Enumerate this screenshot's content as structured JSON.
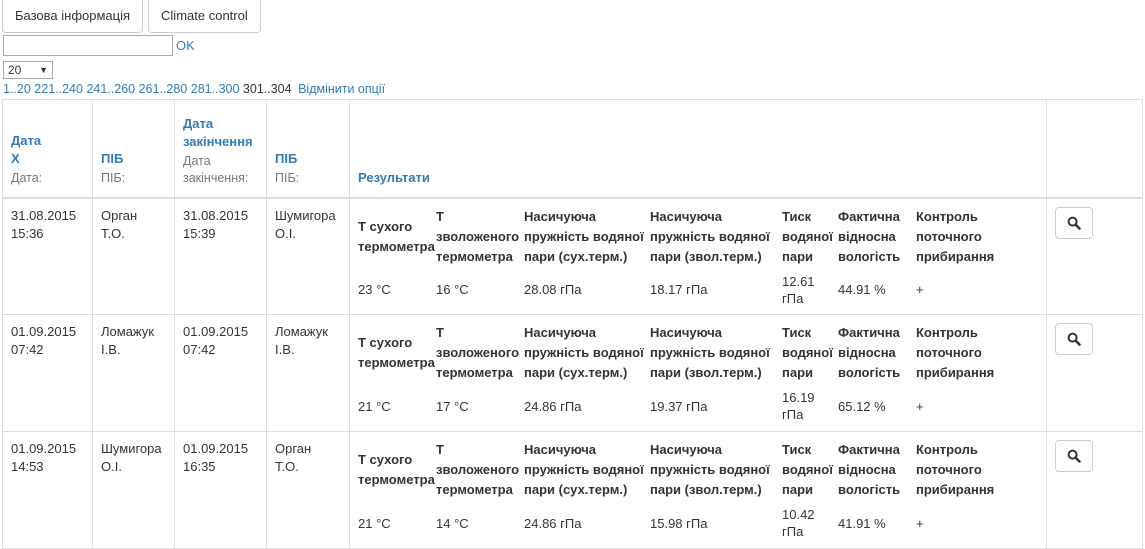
{
  "tabs": [
    "Базова інформація",
    "Climate control"
  ],
  "search": {
    "value": "",
    "ok_label": "OK"
  },
  "page_size": {
    "selected": "20"
  },
  "pager": {
    "links": [
      "1..20",
      "221..240",
      "241..260",
      "261..280",
      "281..300"
    ],
    "current": "301..304",
    "cancel_label": "Відмінити опції"
  },
  "table": {
    "headers": [
      {
        "title_line1": "Дата",
        "title_line2": "X",
        "sub": "Дата:"
      },
      {
        "title": "ПІБ",
        "sub": "ПІБ:"
      },
      {
        "title_line1": "Дата",
        "title_line2": "закінчення",
        "sub_line1": "Дата",
        "sub_line2": "закінчення:"
      },
      {
        "title": "ПІБ",
        "sub": "ПІБ:"
      },
      {
        "title": "Результати"
      }
    ],
    "result_headers": [
      [
        "Т сухого",
        "термометра"
      ],
      [
        "Т",
        "зволоженого",
        "термометра"
      ],
      [
        "Насичуюча",
        "пружність водяної",
        "пари (сух.терм.)"
      ],
      [
        "Насичуюча",
        "пружність водяної",
        "пари (звол.терм.)"
      ],
      [
        "Тиск",
        "водяної",
        "пари"
      ],
      [
        "Фактична",
        "відносна",
        "вологість"
      ],
      [
        "Контроль",
        "поточного",
        "прибирання"
      ]
    ],
    "rows": [
      {
        "date": [
          "31.08.2015",
          "15:36"
        ],
        "name": [
          "Орган",
          "Т.О."
        ],
        "end_date": [
          "31.08.2015",
          "15:39"
        ],
        "end_name": [
          "Шумигора",
          "О.І."
        ],
        "results": [
          "23 °C",
          "16 °C",
          "28.08 гПа",
          "18.17 гПа",
          "12.61 гПа",
          "44.91 %",
          "+"
        ]
      },
      {
        "date": [
          "01.09.2015",
          "07:42"
        ],
        "name": [
          "Ломажук",
          "І.В."
        ],
        "end_date": [
          "01.09.2015",
          "07:42"
        ],
        "end_name": [
          "Ломажук",
          "І.В."
        ],
        "results": [
          "21 °C",
          "17 °C",
          "24.86 гПа",
          "19.37 гПа",
          "16.19 гПа",
          "65.12 %",
          "+"
        ]
      },
      {
        "date": [
          "01.09.2015",
          "14:53"
        ],
        "name": [
          "Шумигора",
          "О.І."
        ],
        "end_date": [
          "01.09.2015",
          "16:35"
        ],
        "end_name": [
          "Орган",
          "Т.О."
        ],
        "results": [
          "21 °C",
          "14 °C",
          "24.86 гПа",
          "15.98 гПа",
          "10.42 гПа",
          "41.91 %",
          "+"
        ]
      }
    ]
  },
  "icons": {
    "search": "search-icon"
  }
}
